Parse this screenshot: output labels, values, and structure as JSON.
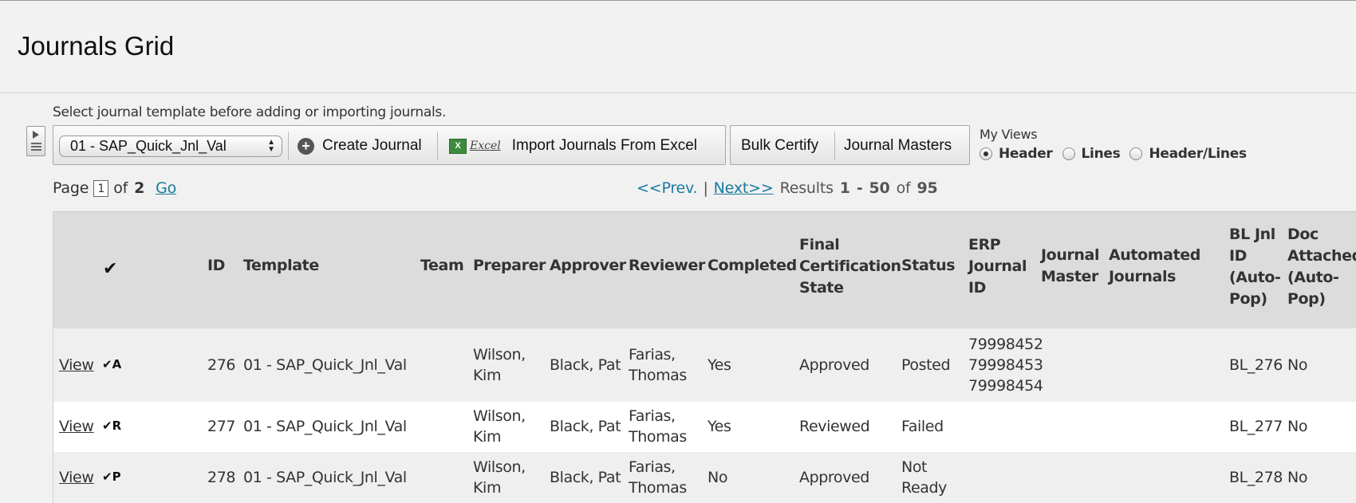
{
  "page": {
    "title": "Journals Grid"
  },
  "toolbar": {
    "hint": "Select journal template before adding or importing journals.",
    "template_select": "01 - SAP_Quick_Jnl_Val",
    "create_label": "Create Journal",
    "excel_glyph": "X",
    "excel_text": "Excel",
    "import_label": "Import Journals From Excel",
    "bulk_certify_label": "Bulk Certify",
    "journal_masters_label": "Journal Masters"
  },
  "views": {
    "label": "My Views",
    "options": [
      {
        "label": "Header",
        "checked": true
      },
      {
        "label": "Lines",
        "checked": false
      },
      {
        "label": "Header/Lines",
        "checked": false
      }
    ]
  },
  "pager": {
    "page_label": "Page",
    "current": "1",
    "of_label": "of",
    "total": "2",
    "go": "Go",
    "prev": "<<Prev.",
    "divider": "|",
    "next": "Next>>",
    "results_label": "Results",
    "start": "1",
    "dash": "-",
    "end": "50",
    "of2": "of",
    "count": "95"
  },
  "grid": {
    "headers": {
      "check": "✔",
      "id": "ID",
      "template": "Template",
      "team": "Team",
      "preparer": "Preparer",
      "approver": "Approver",
      "reviewer": "Reviewer",
      "completed": "Completed",
      "final_cert_l1": "Final",
      "final_cert_l2": "Certification",
      "final_cert_l3": "State",
      "status": "Status",
      "erp_l1": "ERP",
      "erp_l2": "Journal",
      "erp_l3": "ID",
      "jm_l1": "Journal",
      "jm_l2": "Master",
      "aj_l1": "Automated",
      "aj_l2": "Journals",
      "bl_l1": "BL Jnl",
      "bl_l2": "ID",
      "bl_l3": "(Auto-",
      "bl_l4": "Pop)",
      "doc_l1": "Doc",
      "doc_l2": "Attached",
      "doc_l3": "(Auto-",
      "doc_l4": "Pop)"
    },
    "rows": [
      {
        "view": "View",
        "badge": "✔A",
        "id": "276",
        "template": "01 - SAP_Quick_Jnl_Val",
        "preparer_l1": "Wilson,",
        "preparer_l2": "Kim",
        "approver": "Black, Pat",
        "reviewer_l1": "Farias,",
        "reviewer_l2": "Thomas",
        "completed": "Yes",
        "final_cert": "Approved",
        "status_l1": "Posted",
        "status_l2": "",
        "erp": [
          "79998452",
          "79998453",
          "79998454"
        ],
        "bl_id": "BL_276",
        "doc": "No"
      },
      {
        "view": "View",
        "badge": "✔R",
        "id": "277",
        "template": "01 - SAP_Quick_Jnl_Val",
        "preparer_l1": "Wilson,",
        "preparer_l2": "Kim",
        "approver": "Black, Pat",
        "reviewer_l1": "Farias,",
        "reviewer_l2": "Thomas",
        "completed": "Yes",
        "final_cert": "Reviewed",
        "status_l1": "Failed",
        "status_l2": "",
        "erp": [
          "",
          "",
          ""
        ],
        "bl_id": "BL_277",
        "doc": "No"
      },
      {
        "view": "View",
        "badge": "✔P",
        "id": "278",
        "template": "01 - SAP_Quick_Jnl_Val",
        "preparer_l1": "Wilson,",
        "preparer_l2": "Kim",
        "approver": "Black, Pat",
        "reviewer_l1": "Farias,",
        "reviewer_l2": "Thomas",
        "completed": "No",
        "final_cert": "Approved",
        "status_l1": "Not",
        "status_l2": "Ready",
        "erp": [
          "",
          "",
          ""
        ],
        "bl_id": "BL_278",
        "doc": "No"
      }
    ]
  }
}
